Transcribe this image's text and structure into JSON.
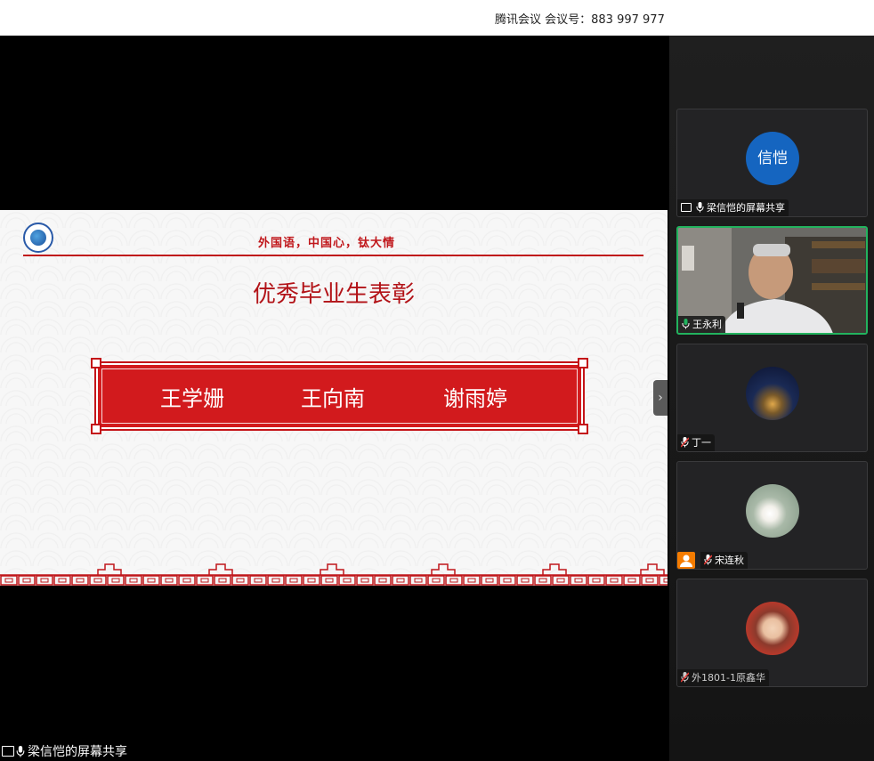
{
  "meeting": {
    "title": "腾讯会议 会议号：883 997 977"
  },
  "slide": {
    "motto": "外国语，中国心，钛大情",
    "heading": "优秀毕业生表彰",
    "names": [
      "王学姗",
      "王向南",
      "谢雨婷"
    ]
  },
  "participants": [
    {
      "label": "梁信恺的屏幕共享",
      "avatar_text": "信恺",
      "avatar_color": "#1565c0",
      "mic": "on",
      "sharing": true
    },
    {
      "label": "王永利",
      "mic": "on",
      "video": true
    },
    {
      "label": "丁一",
      "mic": "muted"
    },
    {
      "label": "宋连秋",
      "mic": "muted",
      "host": true
    },
    {
      "label": "外1801-1原鑫华",
      "mic": "muted"
    }
  ],
  "bottom_status": {
    "label": "梁信恺的屏幕共享"
  },
  "colors": {
    "accent_green": "#22b35e",
    "slide_red": "#d21a1d"
  }
}
